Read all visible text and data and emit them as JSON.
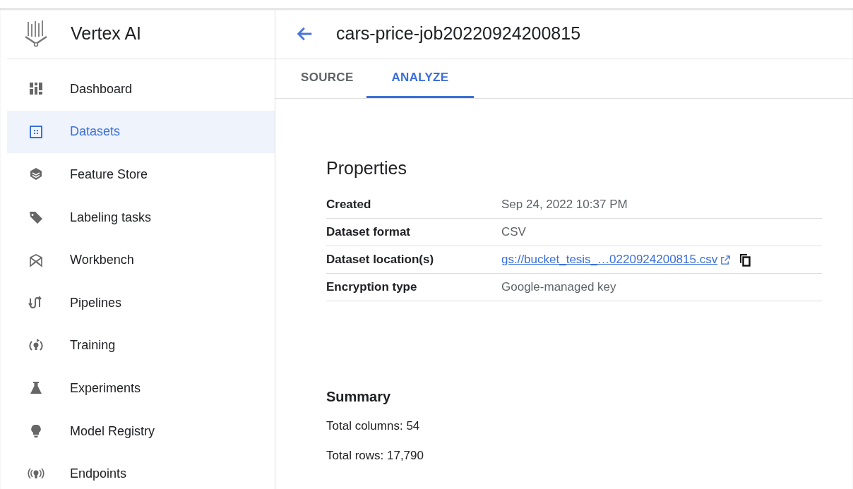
{
  "app": {
    "title": "Vertex AI"
  },
  "sidebar": {
    "items": [
      {
        "label": "Dashboard",
        "kind": "dashboard",
        "selected": false
      },
      {
        "label": "Datasets",
        "kind": "datasets",
        "selected": true
      },
      {
        "label": "Feature Store",
        "kind": "layers",
        "selected": false
      },
      {
        "label": "Labeling tasks",
        "kind": "tag",
        "selected": false
      },
      {
        "label": "Workbench",
        "kind": "workbench",
        "selected": false
      },
      {
        "label": "Pipelines",
        "kind": "pipelines",
        "selected": false
      },
      {
        "label": "Training",
        "kind": "training",
        "selected": false
      },
      {
        "label": "Experiments",
        "kind": "flask",
        "selected": false
      },
      {
        "label": "Model Registry",
        "kind": "bulb",
        "selected": false
      },
      {
        "label": "Endpoints",
        "kind": "endpoints",
        "selected": false
      }
    ]
  },
  "page": {
    "title": "cars-price-job20220924200815"
  },
  "tabs": [
    {
      "label": "SOURCE",
      "selected": false
    },
    {
      "label": "ANALYZE",
      "selected": true
    }
  ],
  "properties": {
    "title": "Properties",
    "rows": [
      {
        "label": "Created",
        "value": "Sep 24, 2022 10:37 PM",
        "kind": "text"
      },
      {
        "label": "Dataset format",
        "value": "CSV",
        "kind": "text"
      },
      {
        "label": "Dataset location(s)",
        "value": "gs://bucket_tesis_…0220924200815.csv",
        "kind": "link"
      },
      {
        "label": "Encryption type",
        "value": "Google-managed key",
        "kind": "text"
      }
    ]
  },
  "summary": {
    "title": "Summary",
    "lines": [
      "Total columns: 54",
      "Total rows: 17,790"
    ]
  }
}
